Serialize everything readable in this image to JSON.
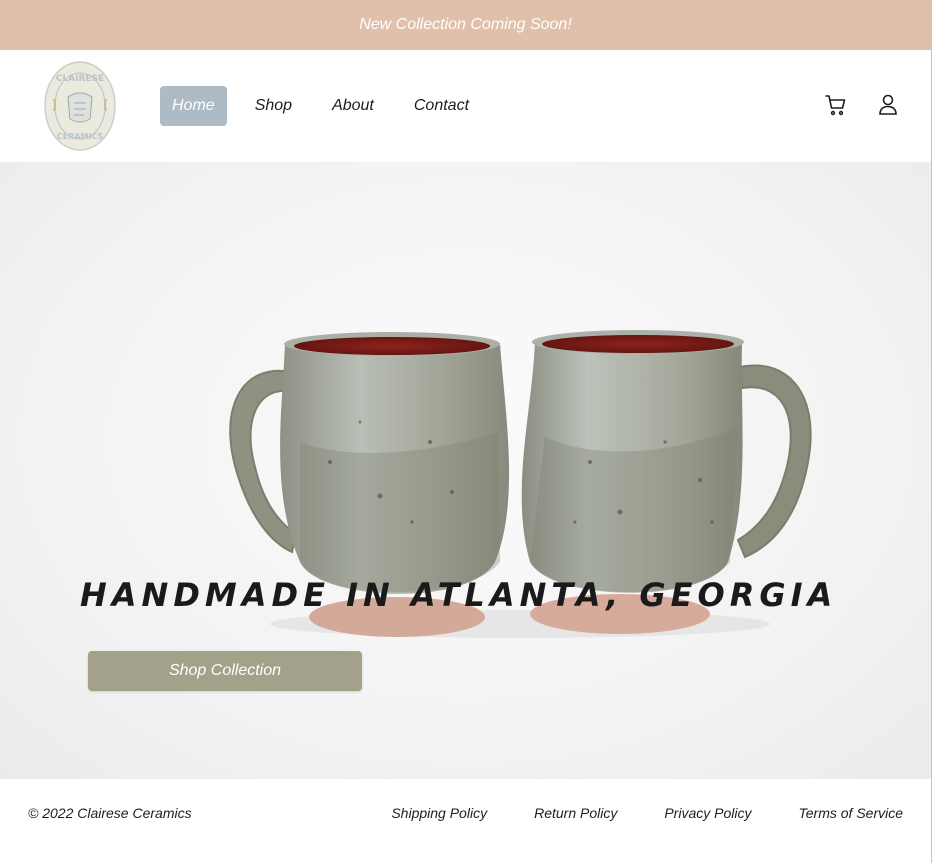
{
  "announcement": {
    "text": "New Collection Coming Soon!"
  },
  "logo": {
    "name": "logo",
    "lettering": [
      "CLAIRESE",
      "CERAMICS"
    ],
    "colors": {
      "bg": "#eaeadf",
      "accent": "#b9c3c8",
      "ink": "#8a9aa2"
    }
  },
  "nav": {
    "items": [
      {
        "label": "Home",
        "active": true
      },
      {
        "label": "Shop",
        "active": false
      },
      {
        "label": "About",
        "active": false
      },
      {
        "label": "Contact",
        "active": false
      }
    ]
  },
  "header_icons": {
    "cart": "cart-icon",
    "account": "user-icon"
  },
  "hero": {
    "title": "HANDMADE IN ATLANTA, GEORGIA",
    "button_label": "Shop Collection"
  },
  "footer": {
    "copyright": "© 2022 Clairese Ceramics",
    "links": [
      "Shipping Policy",
      "Return Policy",
      "Privacy Policy",
      "Terms of Service"
    ]
  },
  "colors": {
    "announcement_bg": "#e0bfab",
    "nav_active_bg": "#aebbc5",
    "button_bg": "#a3a18a",
    "text": "#1e1e1e",
    "mug_glaze": "#a6aba1",
    "mug_interior": "#7a1a16"
  }
}
